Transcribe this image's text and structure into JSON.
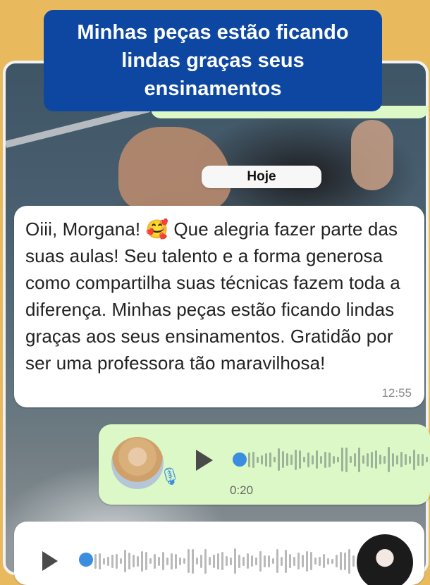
{
  "banner": {
    "caption": "Minhas peças estão ficando\nlindas graças seus\nensinamentos"
  },
  "chat": {
    "day_label": "Hoje",
    "incoming_message": {
      "text": "Oiii, Morgana! 🥰 Que alegria fazer parte das suas aulas! Seu talento e a forma generosa como compartilha suas técnicas fazem toda a diferença. Minhas peças estão ficando lindas graças aos seus ensinamentos. Gratidão por ser uma professora tão maravilhosa!",
      "time": "12:55"
    },
    "outgoing_audio": {
      "duration": "0:20",
      "progress": 0.0,
      "play_icon": "play-icon",
      "mic_icon": "mic-icon"
    },
    "incoming_audio": {
      "progress": 0.0,
      "play_icon": "play-icon"
    }
  },
  "colors": {
    "background": "#e9b95e",
    "banner": "#0d47a1",
    "outgoing_bubble": "#dcf8c6",
    "incoming_bubble": "#ffffff",
    "accent": "#3b8de0"
  }
}
